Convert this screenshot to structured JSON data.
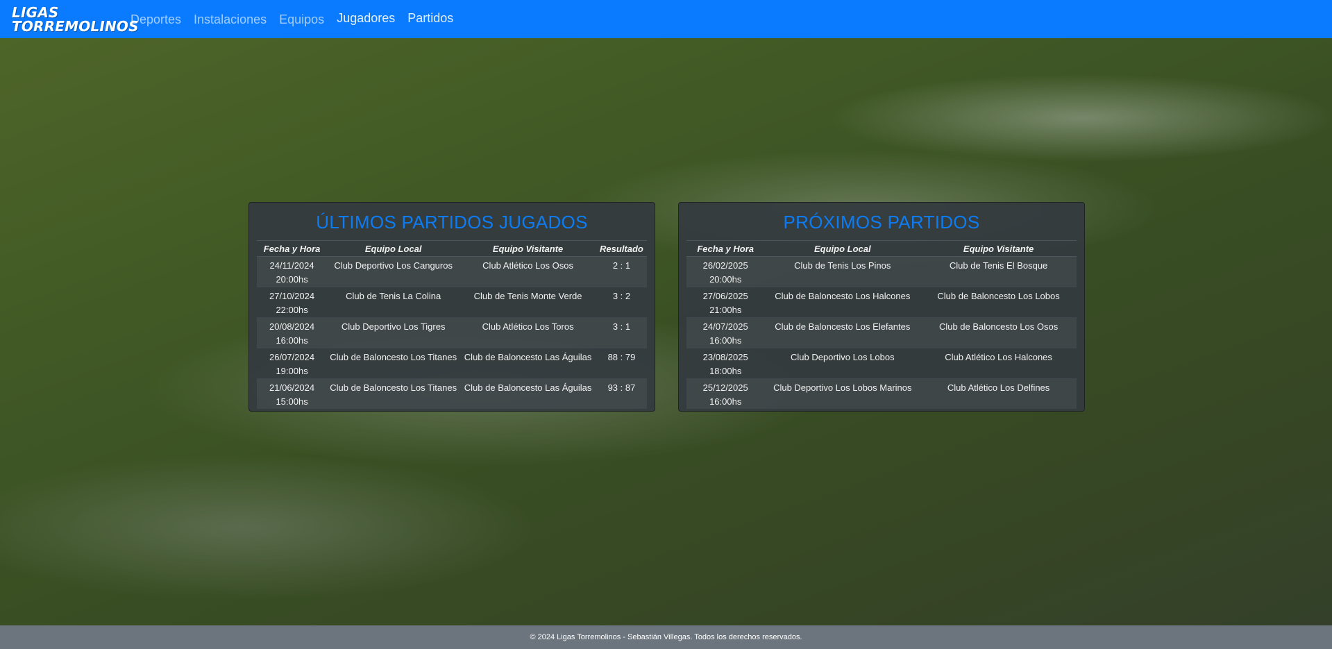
{
  "brand": {
    "line1": "LIGAS",
    "line2": "TORREMOLINOS"
  },
  "nav": [
    "Deportes",
    "Instalaciones",
    "Equipos",
    "Jugadores",
    "Partidos"
  ],
  "played": {
    "title": "ÚLTIMOS PARTIDOS JUGADOS",
    "headers": [
      "Fecha y Hora",
      "Equipo Local",
      "Equipo Visitante",
      "Resultado"
    ],
    "rows": [
      {
        "date": "24/11/2024",
        "time": "20:00hs",
        "home": "Club Deportivo Los Canguros",
        "away": "Club Atlético Los Osos",
        "result": "2 : 1"
      },
      {
        "date": "27/10/2024",
        "time": "22:00hs",
        "home": "Club de Tenis La Colina",
        "away": "Club de Tenis Monte Verde",
        "result": "3 : 2"
      },
      {
        "date": "20/08/2024",
        "time": "16:00hs",
        "home": "Club Deportivo Los Tigres",
        "away": "Club Atlético Los Toros",
        "result": "3 : 1"
      },
      {
        "date": "26/07/2024",
        "time": "19:00hs",
        "home": "Club de Baloncesto Los Titanes",
        "away": "Club de Baloncesto Las Águilas",
        "result": "88 : 79"
      },
      {
        "date": "21/06/2024",
        "time": "15:00hs",
        "home": "Club de Baloncesto Los Titanes",
        "away": "Club de Baloncesto Las Águilas",
        "result": "93 : 87"
      }
    ]
  },
  "upcoming": {
    "title": "PRÓXIMOS PARTIDOS",
    "headers": [
      "Fecha y Hora",
      "Equipo Local",
      "Equipo Visitante"
    ],
    "rows": [
      {
        "date": "26/02/2025",
        "time": "20:00hs",
        "home": "Club de Tenis Los Pinos",
        "away": "Club de Tenis El Bosque"
      },
      {
        "date": "27/06/2025",
        "time": "21:00hs",
        "home": "Club de Baloncesto Los Halcones",
        "away": "Club de Baloncesto Los Lobos"
      },
      {
        "date": "24/07/2025",
        "time": "16:00hs",
        "home": "Club de Baloncesto Los Elefantes",
        "away": "Club de Baloncesto Los Osos"
      },
      {
        "date": "23/08/2025",
        "time": "18:00hs",
        "home": "Club Deportivo Los Lobos",
        "away": "Club Atlético Los Halcones"
      },
      {
        "date": "25/12/2025",
        "time": "16:00hs",
        "home": "Club Deportivo Los Lobos Marinos",
        "away": "Club Atlético Los Delfines"
      }
    ]
  },
  "footer": "© 2024 Ligas Torremolinos - Sebastián Villegas. Todos los derechos reservados.",
  "colors": {
    "navbar": "#0a7bff",
    "title": "#0d7cf2",
    "panel": "#343a40",
    "footer": "#6c757d"
  }
}
